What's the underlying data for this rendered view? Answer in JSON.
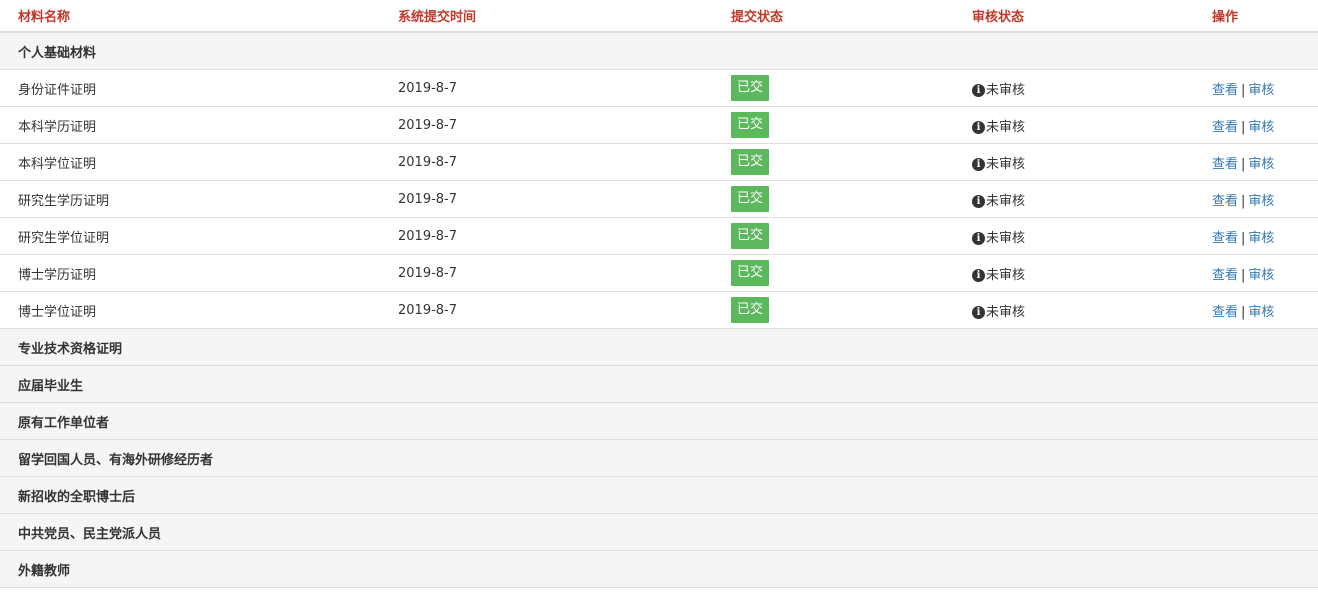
{
  "headers": {
    "name": "材料名称",
    "time": "系统提交时间",
    "submit_status": "提交状态",
    "review_status": "审核状态",
    "action": "操作"
  },
  "groups": [
    {
      "title": "个人基础材料",
      "rows": [
        {
          "name": "身份证件证明",
          "time": "2019-8-7",
          "submit_status": "已交",
          "review_status": "未审核",
          "view": "查看",
          "review": "审核"
        },
        {
          "name": "本科学历证明",
          "time": "2019-8-7",
          "submit_status": "已交",
          "review_status": "未审核",
          "view": "查看",
          "review": "审核"
        },
        {
          "name": "本科学位证明",
          "time": "2019-8-7",
          "submit_status": "已交",
          "review_status": "未审核",
          "view": "查看",
          "review": "审核"
        },
        {
          "name": "研究生学历证明",
          "time": "2019-8-7",
          "submit_status": "已交",
          "review_status": "未审核",
          "view": "查看",
          "review": "审核"
        },
        {
          "name": "研究生学位证明",
          "time": "2019-8-7",
          "submit_status": "已交",
          "review_status": "未审核",
          "view": "查看",
          "review": "审核"
        },
        {
          "name": "博士学历证明",
          "time": "2019-8-7",
          "submit_status": "已交",
          "review_status": "未审核",
          "view": "查看",
          "review": "审核"
        },
        {
          "name": "博士学位证明",
          "time": "2019-8-7",
          "submit_status": "已交",
          "review_status": "未审核",
          "view": "查看",
          "review": "审核"
        }
      ]
    },
    {
      "title": "专业技术资格证明",
      "rows": []
    },
    {
      "title": "应届毕业生",
      "rows": []
    },
    {
      "title": "原有工作单位者",
      "rows": []
    },
    {
      "title": "留学回国人员、有海外研修经历者",
      "rows": []
    },
    {
      "title": "新招收的全职博士后",
      "rows": []
    },
    {
      "title": "中共党员、民主党派人员",
      "rows": []
    },
    {
      "title": "外籍教师",
      "rows": []
    }
  ],
  "separator": "|",
  "colors": {
    "header_text": "#c0392b",
    "badge_bg": "#5cb85c",
    "link": "#337ab7",
    "group_bg": "#f5f5f5"
  },
  "icons": {
    "review_status": "info-circle-icon"
  }
}
